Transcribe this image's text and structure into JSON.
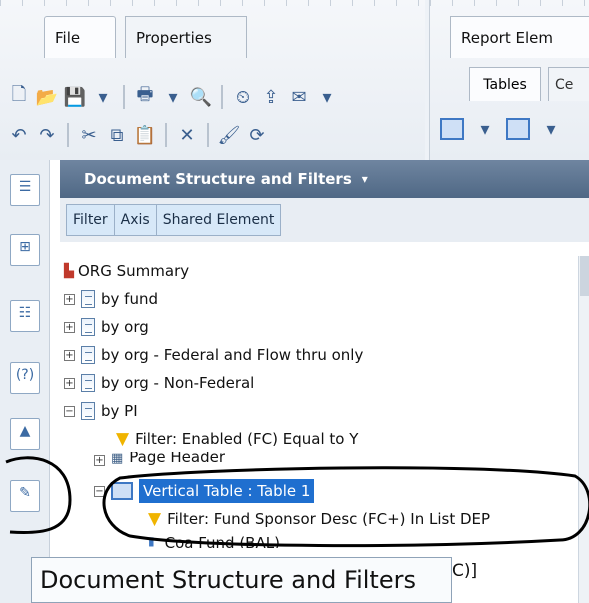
{
  "tabs": {
    "file": "File",
    "properties": "Properties",
    "report_elements": "Report Elem"
  },
  "subtabs": {
    "tables": "Tables",
    "ce": "Ce"
  },
  "panel": {
    "title": "Document Structure and Filters",
    "filter_tabs": [
      "Filter",
      "Axis",
      "Shared Element"
    ]
  },
  "tree": {
    "root": "ORG Summary",
    "items": [
      {
        "label": "by fund"
      },
      {
        "label": "by org"
      },
      {
        "label": "by org - Federal and Flow thru only"
      },
      {
        "label": "by org - Non-Federal"
      },
      {
        "label": "by PI"
      }
    ],
    "filter_pi": "Filter: Enabled (FC) Equal to Y",
    "page_header": "Page Header",
    "vertical_table": "Vertical Table : Table 1",
    "filter_table": "Filter: Fund Sponsor Desc (FC+) In List DEP",
    "coa_fund": "Coa Fund (BAL)"
  },
  "tooltip": {
    "text": "Document Structure and Filters",
    "tail": "C)]"
  },
  "colors": {
    "header_bg": "#5a7391",
    "selection": "#1f6fcf",
    "funnel": "#f0b400",
    "annotation": "#000000"
  },
  "icons": {
    "side": [
      "document-icon",
      "structure-icon",
      "list-icon",
      "help-icon",
      "picture-icon",
      "edit-document-icon"
    ]
  }
}
